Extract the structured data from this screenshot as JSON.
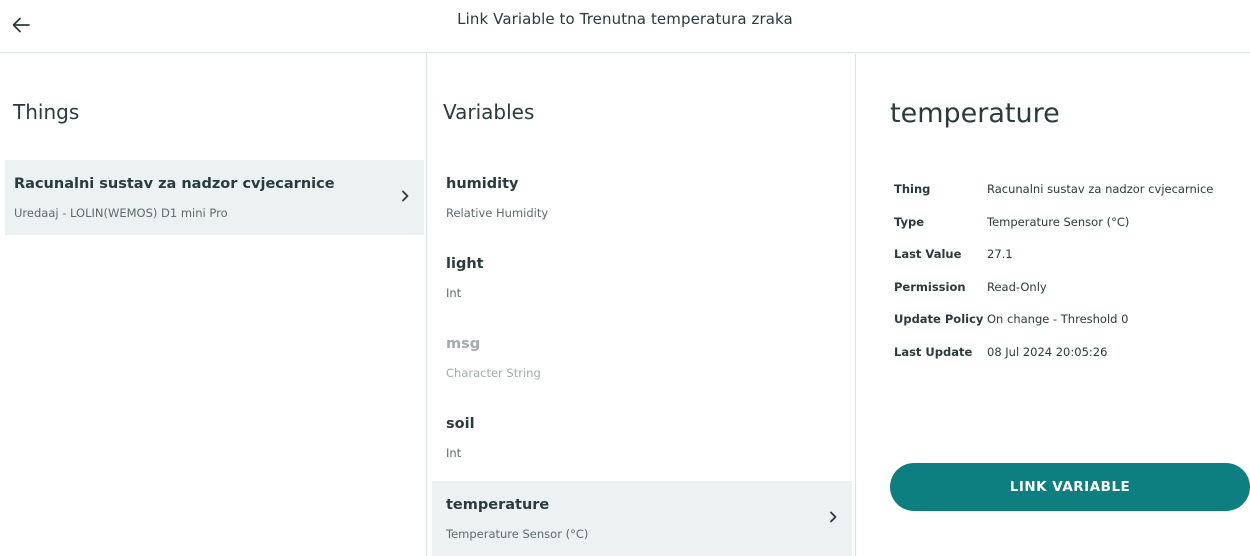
{
  "header": {
    "title": "Link Variable to Trenutna temperatura zraka",
    "back_icon": "arrow-left-icon"
  },
  "things": {
    "heading": "Things",
    "items": [
      {
        "name": "Racunalni sustav za nadzor cvjecarnice",
        "device": "Uredaaj - LOLIN(WEMOS) D1 mini Pro",
        "selected": true
      }
    ]
  },
  "variables": {
    "heading": "Variables",
    "items": [
      {
        "name": "humidity",
        "type": "Relative Humidity",
        "disabled": false,
        "selected": false
      },
      {
        "name": "light",
        "type": "Int",
        "disabled": false,
        "selected": false
      },
      {
        "name": "msg",
        "type": "Character String",
        "disabled": true,
        "selected": false
      },
      {
        "name": "soil",
        "type": "Int",
        "disabled": false,
        "selected": false
      },
      {
        "name": "temperature",
        "type": "Temperature Sensor (°C)",
        "disabled": false,
        "selected": true
      }
    ]
  },
  "detail": {
    "title": "temperature",
    "rows": [
      {
        "label": "Thing",
        "value": "Racunalni sustav za nadzor cvjecarnice"
      },
      {
        "label": "Type",
        "value": "Temperature Sensor (°C)"
      },
      {
        "label": "Last Value",
        "value": "27.1"
      },
      {
        "label": "Permission",
        "value": "Read-Only"
      },
      {
        "label": "Update Policy",
        "value": "On change - Threshold 0"
      },
      {
        "label": "Last Update",
        "value": "08 Jul 2024 20:05:26"
      }
    ],
    "button_label": "LINK VARIABLE"
  },
  "colors": {
    "accent": "#0d7f81",
    "selected_bg": "#ecf1f1",
    "text": "#2b3b3c",
    "muted_text": "#5f6b6c",
    "disabled_text": "#a3abac"
  }
}
